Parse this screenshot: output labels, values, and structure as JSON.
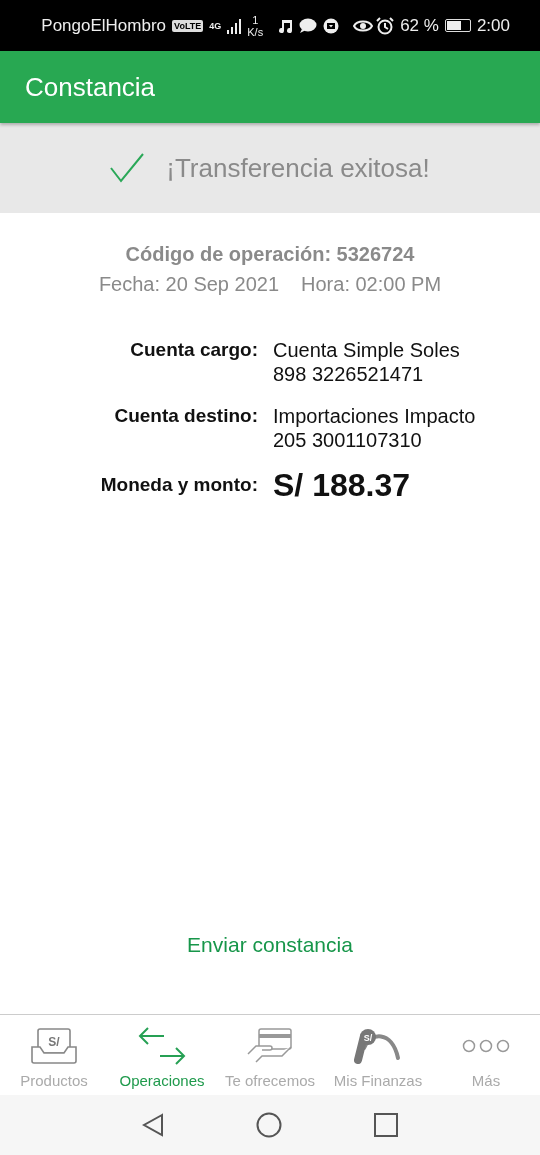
{
  "status_bar": {
    "carrier": "PongoElHombro",
    "volte": "VoLTE",
    "network": "4G",
    "speed_value": "1",
    "speed_unit": "K/s",
    "battery_text": "62 %",
    "time": "2:00"
  },
  "app_bar": {
    "title": "Constancia"
  },
  "banner": {
    "message": "¡Transferencia exitosa!"
  },
  "receipt": {
    "operation_code": "Código de operación: 5326724",
    "date": "Fecha: 20 Sep 2021",
    "time": "Hora: 02:00 PM",
    "fields": [
      {
        "label": "Cuenta cargo:",
        "lines": [
          "Cuenta Simple Soles",
          "898 3226521471"
        ],
        "kind": "text"
      },
      {
        "label": "Cuenta destino:",
        "lines": [
          "Importaciones Impacto",
          "205 3001107310"
        ],
        "kind": "text"
      },
      {
        "label": "Moneda y monto:",
        "lines": [
          "S/ 188.37"
        ],
        "kind": "amount"
      }
    ]
  },
  "send_link": "Enviar constancia",
  "bottom_nav": [
    {
      "label": "Productos",
      "icon_text": "S/",
      "selected": false
    },
    {
      "label": "Operaciones",
      "selected": true
    },
    {
      "label": "Te ofrecemos",
      "selected": false
    },
    {
      "label": "Mis Finanzas",
      "icon_text": "S/",
      "selected": false
    },
    {
      "label": "Más",
      "selected": false
    }
  ]
}
